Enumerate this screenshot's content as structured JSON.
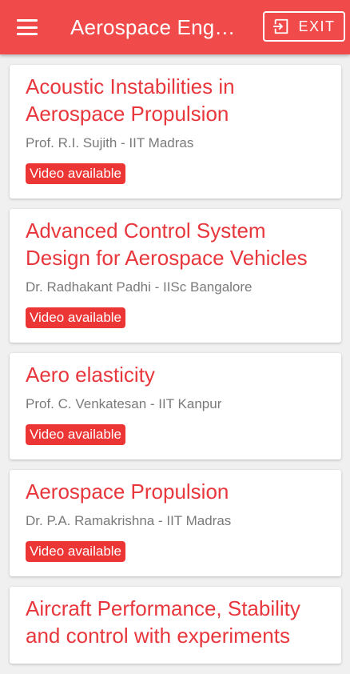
{
  "appbar": {
    "title": "Aerospace Eng…",
    "exit_label": "EXIT",
    "menu_icon": "menu-icon",
    "exit_icon": "exit-icon",
    "color": "#f04a4a"
  },
  "courses": [
    {
      "title": "Acoustic Instabilities in Aerospace Propulsion",
      "instructor": "Prof. R.I. Sujith - IIT Madras",
      "badge": "Video available"
    },
    {
      "title": "Advanced Control System Design for Aerospace Vehicles",
      "instructor": "Dr. Radhakant Padhi - IISc Bangalore",
      "badge": "Video available"
    },
    {
      "title": "Aero elasticity",
      "instructor": "Prof. C. Venkatesan - IIT Kanpur",
      "badge": "Video available"
    },
    {
      "title": "Aerospace Propulsion",
      "instructor": "Dr. P.A. Ramakrishna - IIT Madras",
      "badge": "Video available"
    },
    {
      "title": "Aircraft Performance, Stability and control with experiments",
      "instructor": "",
      "badge": ""
    }
  ],
  "accent_color": "#e8373c"
}
